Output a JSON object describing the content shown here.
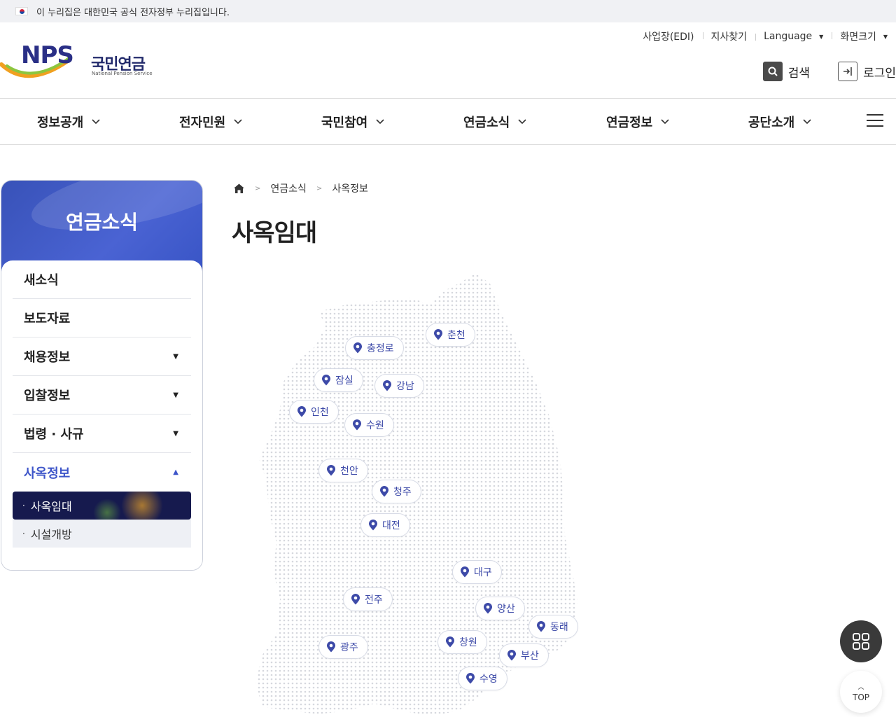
{
  "gov_banner": {
    "text": "이 누리집은 대한민국 공식 전자정부 누리집입니다."
  },
  "logo": {
    "mark": "NPS",
    "korean": "국민연금",
    "english": "National Pension Service"
  },
  "util_links": [
    {
      "label": "사업장(EDI)",
      "has_caret": false
    },
    {
      "label": "지사찾기",
      "has_caret": false
    },
    {
      "label": "Language",
      "has_caret": true
    },
    {
      "label": "화면크기",
      "has_caret": true
    }
  ],
  "actions": {
    "search": "검색",
    "login": "로그인"
  },
  "gnb": [
    "정보공개",
    "전자민원",
    "국민참여",
    "연금소식",
    "연금정보",
    "공단소개"
  ],
  "lnb": {
    "title": "연금소식",
    "items": [
      {
        "label": "새소식",
        "expandable": false
      },
      {
        "label": "보도자료",
        "expandable": false
      },
      {
        "label": "채용정보",
        "expandable": true
      },
      {
        "label": "입찰정보",
        "expandable": true
      },
      {
        "label": "법령 · 사규",
        "expandable": true
      },
      {
        "label": "사옥정보",
        "expandable": true,
        "active": true
      }
    ],
    "sub_items": [
      "사옥임대",
      "시설개방"
    ],
    "sub_selected": "사옥임대"
  },
  "breadcrumb": [
    "연금소식",
    "사옥정보"
  ],
  "page_title": "사옥임대",
  "map_pins": [
    "춘천",
    "충정로",
    "잠실",
    "강남",
    "인천",
    "수원",
    "천안",
    "청주",
    "대전",
    "대구",
    "전주",
    "양산",
    "동래",
    "창원",
    "광주",
    "부산",
    "수영"
  ],
  "floating": {
    "top_label": "TOP"
  },
  "colors": {
    "brand_navy": "#222a6b",
    "accent_blue": "#3d55c9",
    "pin_text": "#3d4aa8"
  }
}
